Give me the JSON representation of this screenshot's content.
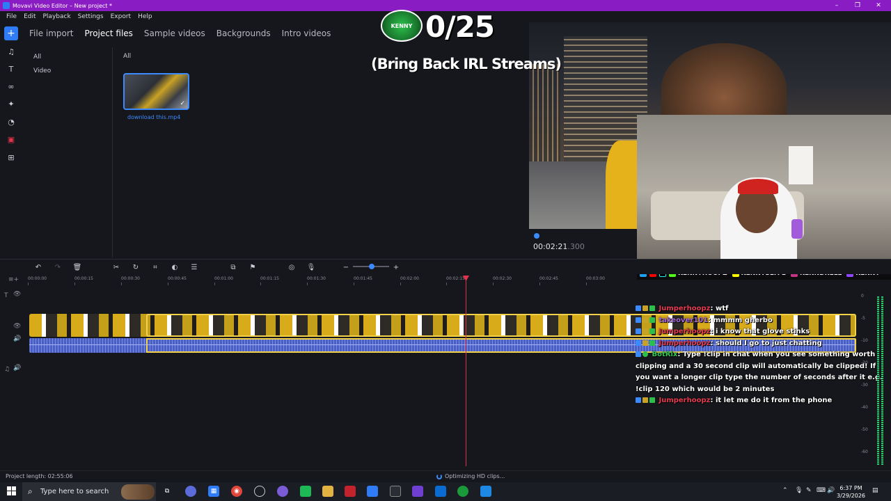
{
  "window": {
    "title": "Movavi Video Editor – New project *",
    "controls": [
      "–",
      "❐",
      "✕"
    ]
  },
  "menu": [
    "File",
    "Edit",
    "Playback",
    "Settings",
    "Export",
    "Help"
  ],
  "tools": [
    "add-icon",
    "music-icon",
    "text-icon",
    "transitions-icon",
    "effects-icon",
    "sticker-icon",
    "record-icon",
    "more-tools-icon"
  ],
  "media_tabs": [
    "File import",
    "Project files",
    "Sample videos",
    "Backgrounds",
    "Intro videos"
  ],
  "media_tab_active": "Project files",
  "categories": [
    "All",
    "Video"
  ],
  "media_header": "All",
  "media_files": [
    {
      "name": "download this.mp4"
    }
  ],
  "overlay": {
    "logo_text": "KENNY",
    "counter": "0/25",
    "subtitle": "(Bring Back IRL Streams)"
  },
  "preview": {
    "timecode": "00:02:21",
    "timecode_ms": ".300"
  },
  "social_handles": [
    "KENNYHOOPZ",
    "KENNYSLYFE",
    "KENNDRELL",
    "KENNY"
  ],
  "ruler_ticks": [
    "00:00:00",
    "00:00:15",
    "00:00:30",
    "00:00:45",
    "00:01:00",
    "00:01:15",
    "00:01:30",
    "00:01:45",
    "00:02:00",
    "00:02:15",
    "00:02:30",
    "00:02:45",
    "00:03:00"
  ],
  "chat": [
    {
      "user": "Jumperhoopz",
      "text": ": wtf",
      "bot": false
    },
    {
      "user": "takeover101",
      "text": ": mmmm gherbo",
      "bot": false
    },
    {
      "user": "Jumperhoopz",
      "text": ": i know that glove stinks",
      "bot": false
    },
    {
      "user": "Jumperhoopz",
      "text": ": should I go to just chatting",
      "bot": false
    },
    {
      "user": "BotRix",
      "text": ": Type !clip in chat when you see something worth clipping and a 30 second clip will automatically be clipped! If you want a longer clip type the number of seconds after it e.g. !clip 120 which would be 2 minutes",
      "bot": true
    },
    {
      "user": "Jumperhoopz",
      "text": ": it let me do it from the phone",
      "bot": false
    }
  ],
  "vu_labels": [
    "0",
    "-5",
    "-10",
    "-20",
    "-30",
    "-40",
    "-50",
    "-60"
  ],
  "status": {
    "project_length": "Project length: 02:55:06",
    "progress": "Optimizing HD clips..."
  },
  "taskbar": {
    "search_placeholder": "Type here to search",
    "time": "6:37 PM",
    "date": "3/29/2026"
  },
  "colors": {
    "accent": "#2f7cf6",
    "titlebar": "#8a1cc4",
    "playhead": "#e2334a",
    "selection": "#f3d24a"
  }
}
